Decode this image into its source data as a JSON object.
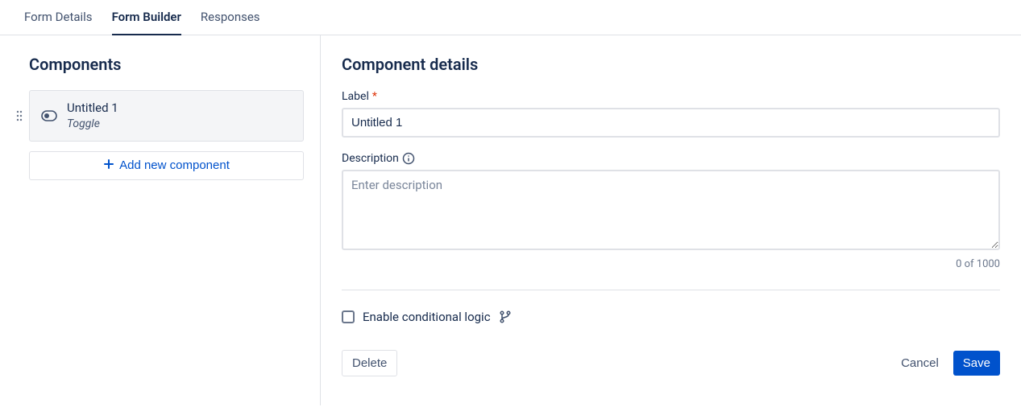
{
  "tabs": [
    {
      "label": "Form Details",
      "active": false
    },
    {
      "label": "Form Builder",
      "active": true
    },
    {
      "label": "Responses",
      "active": false
    }
  ],
  "sidebar": {
    "title": "Components",
    "component": {
      "title": "Untitled 1",
      "type": "Toggle"
    },
    "add_label": "Add new component"
  },
  "details": {
    "title": "Component details",
    "label_field": {
      "label": "Label",
      "required_mark": "*",
      "value": "Untitled 1"
    },
    "description_field": {
      "label": "Description",
      "placeholder": "Enter description",
      "value": "",
      "count": "0 of 1000"
    },
    "conditional": {
      "label": "Enable conditional logic"
    },
    "buttons": {
      "delete": "Delete",
      "cancel": "Cancel",
      "save": "Save"
    }
  }
}
